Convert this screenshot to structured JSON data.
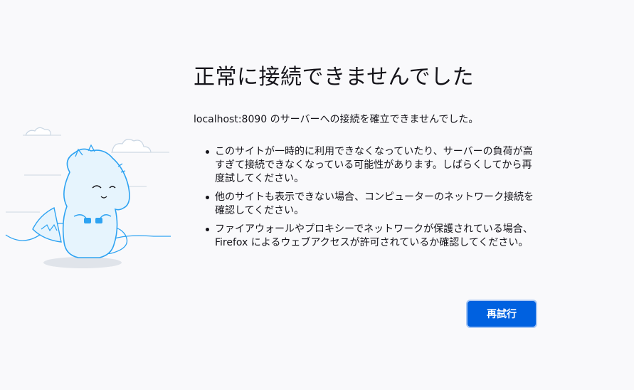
{
  "error_page": {
    "title": "正常に接続できませんでした",
    "description": "localhost:8090 のサーバーへの接続を確立できませんでした。",
    "reasons": [
      "このサイトが一時的に利用できなくなっていたり、サーバーの負荷が高すぎて接続できなくなっている可能性があります。しばらくしてから再度試してください。",
      "他のサイトも表示できない場合、コンピューターのネットワーク接続を確認してください。",
      "ファイアウォールやプロキシーでネットワークが保護されている場合、Firefox によるウェブアクセスが許可されているか確認してください。"
    ],
    "retry_label": "再試行"
  },
  "illustration": {
    "icon": "disconnected-dino-illustration",
    "accent_color": "#2ea3f2"
  },
  "colors": {
    "background": "#f9f9fb",
    "text": "#15141a",
    "button": "#0061e0",
    "button_text": "#ffffff"
  }
}
